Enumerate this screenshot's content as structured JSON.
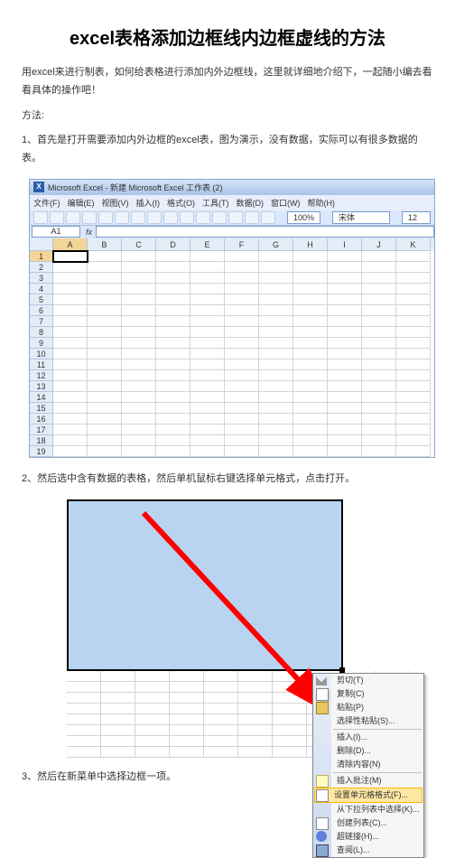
{
  "title": "excel表格添加边框线内边框虚线的方法",
  "intro": "用excel来进行制表，如何给表格进行添加内外边框线，这里就详细地介绍下，一起随小编去看看具体的操作吧！",
  "method_label": "方法:",
  "steps": {
    "s1": "1、首先是打开需要添加内外边框的excel表，图为演示，没有数据，实际可以有很多数据的表。",
    "s2": "2、然后选中含有数据的表格，然后单机鼠标右键选择单元格式，点击打开。",
    "s3": "3、然后在新菜单中选择边框一项。"
  },
  "shot1": {
    "title": "Microsoft Excel - 新建 Microsoft Excel 工作表 (2)",
    "menu": [
      "文件(F)",
      "编辑(E)",
      "视图(V)",
      "插入(I)",
      "格式(O)",
      "工具(T)",
      "数据(D)",
      "窗口(W)",
      "帮助(H)"
    ],
    "name_box": "A1",
    "pct": "100%",
    "font": "宋体",
    "font_size": "12",
    "cols": [
      "A",
      "B",
      "C",
      "D",
      "E",
      "F",
      "G",
      "H",
      "I",
      "J",
      "K"
    ],
    "rows": [
      1,
      2,
      3,
      4,
      5,
      6,
      7,
      8,
      9,
      10,
      11,
      12,
      13,
      14,
      15,
      16,
      17,
      18,
      19
    ]
  },
  "context_menu": {
    "items": [
      {
        "key": "cut",
        "label": "剪切(T)",
        "icon": "cut-icon"
      },
      {
        "key": "copy",
        "label": "复制(C)",
        "icon": "copy-icon"
      },
      {
        "key": "paste",
        "label": "粘贴(P)",
        "icon": "paste-icon"
      },
      {
        "key": "paste_special",
        "label": "选择性粘贴(S)..."
      },
      {
        "sep": true
      },
      {
        "key": "insert",
        "label": "插入(I)..."
      },
      {
        "key": "delete",
        "label": "删除(D)..."
      },
      {
        "key": "clear",
        "label": "清除内容(N)"
      },
      {
        "sep": true
      },
      {
        "key": "comment",
        "label": "插入批注(M)",
        "icon": "comment-icon"
      },
      {
        "key": "format",
        "label": "设置单元格格式(F)...",
        "icon": "format-icon",
        "highlight": true
      },
      {
        "key": "pick",
        "label": "从下拉列表中选择(K)..."
      },
      {
        "key": "create_list",
        "label": "创建列表(C)...",
        "icon": "list-icon"
      },
      {
        "key": "hyperlink",
        "label": "超链接(H)...",
        "icon": "link-icon"
      },
      {
        "key": "lookup",
        "label": "查阅(L)...",
        "icon": "lookup-icon"
      }
    ]
  }
}
